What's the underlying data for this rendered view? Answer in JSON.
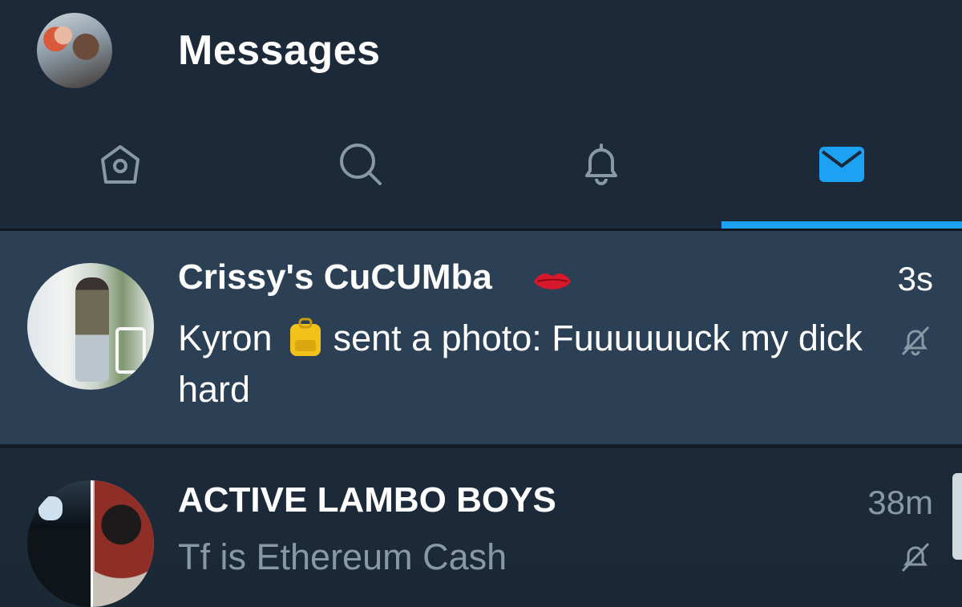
{
  "header": {
    "title": "Messages",
    "profile_avatar_icon": "user-avatar"
  },
  "tabs": [
    {
      "name": "home",
      "icon": "home-icon",
      "active": false
    },
    {
      "name": "search",
      "icon": "search-icon",
      "active": false
    },
    {
      "name": "notifications",
      "icon": "bell-icon",
      "active": false
    },
    {
      "name": "messages",
      "icon": "envelope-icon",
      "active": true
    }
  ],
  "colors": {
    "accent": "#1da1f2",
    "background": "#1c2938",
    "selected_row": "#2b3f55",
    "muted_text": "#8899a6"
  },
  "conversations": [
    {
      "name": "Crissy's CuCUMba",
      "name_emoji": "kiss-mark-icon",
      "time": "3s",
      "preview_sender": "Kyron",
      "preview_emoji": "backpack-icon",
      "preview_text": "sent a photo: Fuuuuuuck my dick hard",
      "muted": true
    },
    {
      "name": "ACTIVE LAMBO BOYS",
      "time": "38m",
      "preview_text": "Tf is Ethereum Cash",
      "muted": true
    }
  ]
}
